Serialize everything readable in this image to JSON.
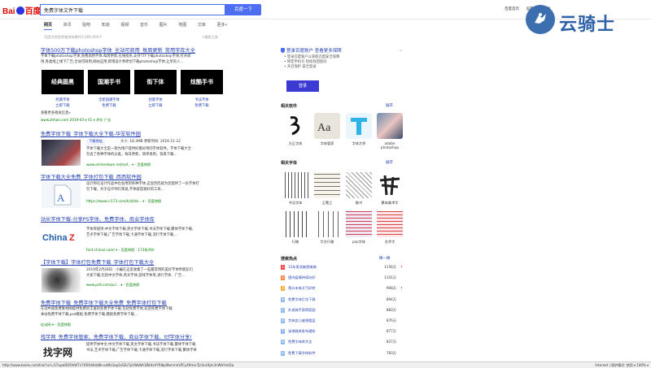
{
  "header": {
    "logo_text": "Bai",
    "logo_text2": "百度",
    "query": "免费字体文件下载",
    "search_button": "百度一下",
    "top_links": [
      "百度首页",
      "设置▼",
      "登录"
    ]
  },
  "watermark": {
    "text": "云骑士"
  },
  "tabs": [
    "网页",
    "资讯",
    "贴吧",
    "知道",
    "视频",
    "音乐",
    "图片",
    "地图",
    "文库",
    "更多»"
  ],
  "result_count": "百度为您找到相关结果约5,060,000个",
  "tools_label": "▽搜索工具",
  "results": {
    "r1": {
      "title": "字体500万下载photoshop字体_全站可商用_每周更新_常用字库大全",
      "desc1": "字体下载photoshop字体,免费商用字体,每周更新,在线找矢,支持TTF下载photoshop字体,打开即",
      "desc2": "用,各类线上线下广告,全站可商用,网站应用,新增设计师原创下载photoshop字体,让所有人...",
      "fonts": [
        {
          "tile": "经典圆黑",
          "label": "经典字体",
          "label2": "立即下载"
        },
        {
          "tile": "国潮手书",
          "label": "全新国潮字体",
          "label2": "免费下载"
        },
        {
          "tile": "街下体",
          "label": "创意字体",
          "label2": "立即下载"
        },
        {
          "tile": "炫酷手书",
          "label": "书法字体",
          "label2": "免费下载"
        }
      ],
      "more": "查看更多相关信息»",
      "url": "www.zhhan.com 2019-03 ▾ V1 ▾ 评价 广告"
    },
    "r2": {
      "title": "免费字体下载_字体下载大全下载-华军软件园",
      "badge": "下载地址",
      "meta": "大小: 18.3MB    更新时间: 2016-11-22",
      "desc1": "字体下载大全是一款为用户提供好看好用的字体软件。字体下载大全",
      "desc2": "包含了各种字体的分类，每日更新，简单易用，快来下载...",
      "url": "www.onlinedown.net/sof... ▾ - 百度快照"
    },
    "r3": {
      "title": "字体下载大全免费_字体打包下载_西西软件园",
      "desc1": "设计师在设计作品中也会用到各种字体,这里西西就为您提供了一份字体打",
      "desc2": "包下载，对于设计师们来说,字体就是很好的工具...",
      "url": "https://www.cr173.com/k/zt/zb... ▾ - 百度快照"
    },
    "r4": {
      "title": "站长字体下载-分享PS字体、免费字体、商业字体库",
      "desc1": "字体库提供,中文字体下载,英文字体下载,书法字体下载,繁体字体下载,",
      "desc2": "艺术字体下载,广告字体下载,卡通字体下载,流行字体下载,...",
      "desc3": "font.chinaz.com/ ▾ - 百度快照 - 173条评价"
    },
    "r5": {
      "title": "【字体下载】字体打包免费下载_字体打包下载大全",
      "desc1": "2019年2月28日 - 小编在这里收集了一些最常用的美好字体供朋友们",
      "desc2": "大家下载,包括中文字体,英文字体,游戏字体等,进行字体、广告...",
      "url": "www.pc6.com/pc/... ▾ - 百度快照"
    },
    "r6": {
      "title": "免费字体下载_免费字体下载大全免费_免费字体打包下载",
      "desc1": "在动中国免费素材网提供免费的丰富的免费字体下载,包括免费字体,欢迎免费字体下载",
      "desc2": "本站免费字体下载,psd模板,免费字体下载,模板免费字体下载,...",
      "url": "红动网 ▾ - 百度快照"
    },
    "r7": {
      "title": "找字网_免费字体管家、免费字体下载、商业字体下载、ttf字体分享!",
      "desc1": "提供字体中文,中文字体下载,英文字体下载,书法字体下载,繁体字体下载",
      "desc2": "书法,艺术字体下载,广告字体下载,卡通字体下载,流行字体下载,繁体字体"
    }
  },
  "right": {
    "login_tip": "登录百度账户 查看更多保障",
    "login_line1": "• 登录百度账户以获取百度安全保障",
    "login_line2": "• 绑定手机号 轻松找回密码",
    "login_line3": "• 开启保护 安全登录",
    "login_button": "登录",
    "software_title": "相关软件",
    "software_more": "展开",
    "software": [
      "方正字体",
      "字体管家",
      "字体大师",
      "adobe photoshop"
    ],
    "fonts_title": "相关字体",
    "fonts_more": "展开",
    "fonts": [
      "书法字体",
      "王羲之",
      "楷书",
      "繁体美术字",
      "行楷",
      "华文行楷",
      "pop字体",
      "艺术字"
    ],
    "hot_title": "搜索热点",
    "hot_more": "换一换",
    "hot": [
      {
        "idx": "1",
        "t": "12年男孩被困电梯",
        "n": "1156万",
        "a": "↑"
      },
      {
        "idx": "2",
        "t": "国内疫情持续向好",
        "n": "1101万",
        "a": ""
      },
      {
        "idx": "3",
        "t": "预计未来天气好转",
        "n": "908万",
        "a": "↑"
      },
      {
        "idx": "4",
        "t": "免费字体打包下载",
        "n": "894万",
        "a": ""
      },
      {
        "idx": "5",
        "t": "外卖骑手获得奖励",
        "n": "883万",
        "a": ""
      },
      {
        "idx": "6",
        "t": "字体女儿被困楼层",
        "n": "876万",
        "a": ""
      },
      {
        "idx": "7",
        "t": "该地政府发布通知",
        "n": "877万",
        "a": ""
      },
      {
        "idx": "8",
        "t": "免费字体库大全",
        "n": "827万",
        "a": ""
      },
      {
        "idx": "9",
        "t": "免费下载字体软件",
        "n": "783万",
        "a": ""
      }
    ]
  },
  "statusbar": {
    "url": "http://www.baidu.com/link?url=S7aywDOOhWTn7XRXdHat8b-oeMz3ap2xSEsTpVWoNA1BKdxVYRIbp9bmmVzPCyX9ma-TJcVuL9jm3nWbYmIQa",
    "right": "Internet | 保护模式: 禁用   ▾ 100% ▾"
  },
  "colors": {
    "accent": "#4e6ef2",
    "link": "#2440b3",
    "url_green": "#008000",
    "hot1": "#f54545",
    "hot2": "#ff8547",
    "hot3": "#ffac38",
    "hot_other": "#8eb9f5"
  }
}
